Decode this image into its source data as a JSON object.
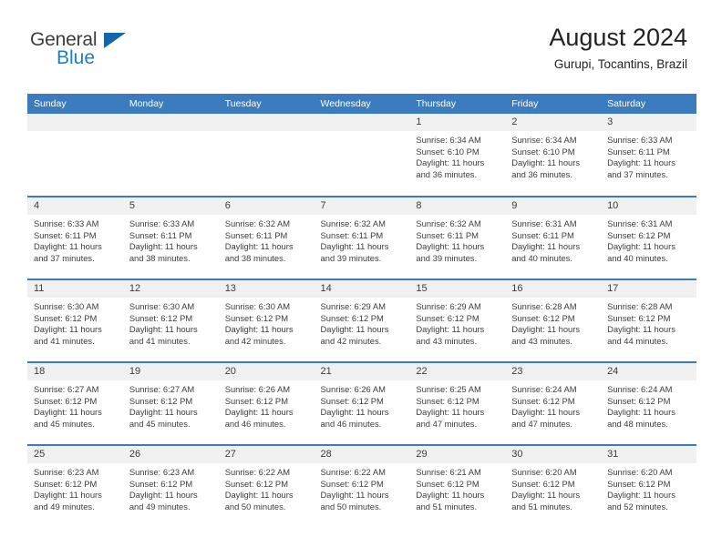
{
  "brand": {
    "name_part1": "General",
    "name_part2": "Blue",
    "triangle_color": "#1565a8",
    "blue_color": "#1b7fc4"
  },
  "header": {
    "title": "August 2024",
    "subtitle": "Gurupi, Tocantins, Brazil"
  },
  "theme": {
    "header_bg": "#3b7cbe",
    "row_border": "#3b7cbe",
    "daynum_bg": "#f0f0f0",
    "text": "#3c3c3c"
  },
  "weekdays": [
    "Sunday",
    "Monday",
    "Tuesday",
    "Wednesday",
    "Thursday",
    "Friday",
    "Saturday"
  ],
  "labels": {
    "sunrise_prefix": "Sunrise: ",
    "sunset_prefix": "Sunset: ",
    "daylight_prefix": "Daylight: "
  },
  "weeks": [
    [
      {
        "day": "",
        "sunrise": "",
        "sunset": "",
        "daylight": ""
      },
      {
        "day": "",
        "sunrise": "",
        "sunset": "",
        "daylight": ""
      },
      {
        "day": "",
        "sunrise": "",
        "sunset": "",
        "daylight": ""
      },
      {
        "day": "",
        "sunrise": "",
        "sunset": "",
        "daylight": ""
      },
      {
        "day": "1",
        "sunrise": "Sunrise: 6:34 AM",
        "sunset": "Sunset: 6:10 PM",
        "daylight": "Daylight: 11 hours and 36 minutes."
      },
      {
        "day": "2",
        "sunrise": "Sunrise: 6:34 AM",
        "sunset": "Sunset: 6:10 PM",
        "daylight": "Daylight: 11 hours and 36 minutes."
      },
      {
        "day": "3",
        "sunrise": "Sunrise: 6:33 AM",
        "sunset": "Sunset: 6:11 PM",
        "daylight": "Daylight: 11 hours and 37 minutes."
      }
    ],
    [
      {
        "day": "4",
        "sunrise": "Sunrise: 6:33 AM",
        "sunset": "Sunset: 6:11 PM",
        "daylight": "Daylight: 11 hours and 37 minutes."
      },
      {
        "day": "5",
        "sunrise": "Sunrise: 6:33 AM",
        "sunset": "Sunset: 6:11 PM",
        "daylight": "Daylight: 11 hours and 38 minutes."
      },
      {
        "day": "6",
        "sunrise": "Sunrise: 6:32 AM",
        "sunset": "Sunset: 6:11 PM",
        "daylight": "Daylight: 11 hours and 38 minutes."
      },
      {
        "day": "7",
        "sunrise": "Sunrise: 6:32 AM",
        "sunset": "Sunset: 6:11 PM",
        "daylight": "Daylight: 11 hours and 39 minutes."
      },
      {
        "day": "8",
        "sunrise": "Sunrise: 6:32 AM",
        "sunset": "Sunset: 6:11 PM",
        "daylight": "Daylight: 11 hours and 39 minutes."
      },
      {
        "day": "9",
        "sunrise": "Sunrise: 6:31 AM",
        "sunset": "Sunset: 6:11 PM",
        "daylight": "Daylight: 11 hours and 40 minutes."
      },
      {
        "day": "10",
        "sunrise": "Sunrise: 6:31 AM",
        "sunset": "Sunset: 6:12 PM",
        "daylight": "Daylight: 11 hours and 40 minutes."
      }
    ],
    [
      {
        "day": "11",
        "sunrise": "Sunrise: 6:30 AM",
        "sunset": "Sunset: 6:12 PM",
        "daylight": "Daylight: 11 hours and 41 minutes."
      },
      {
        "day": "12",
        "sunrise": "Sunrise: 6:30 AM",
        "sunset": "Sunset: 6:12 PM",
        "daylight": "Daylight: 11 hours and 41 minutes."
      },
      {
        "day": "13",
        "sunrise": "Sunrise: 6:30 AM",
        "sunset": "Sunset: 6:12 PM",
        "daylight": "Daylight: 11 hours and 42 minutes."
      },
      {
        "day": "14",
        "sunrise": "Sunrise: 6:29 AM",
        "sunset": "Sunset: 6:12 PM",
        "daylight": "Daylight: 11 hours and 42 minutes."
      },
      {
        "day": "15",
        "sunrise": "Sunrise: 6:29 AM",
        "sunset": "Sunset: 6:12 PM",
        "daylight": "Daylight: 11 hours and 43 minutes."
      },
      {
        "day": "16",
        "sunrise": "Sunrise: 6:28 AM",
        "sunset": "Sunset: 6:12 PM",
        "daylight": "Daylight: 11 hours and 43 minutes."
      },
      {
        "day": "17",
        "sunrise": "Sunrise: 6:28 AM",
        "sunset": "Sunset: 6:12 PM",
        "daylight": "Daylight: 11 hours and 44 minutes."
      }
    ],
    [
      {
        "day": "18",
        "sunrise": "Sunrise: 6:27 AM",
        "sunset": "Sunset: 6:12 PM",
        "daylight": "Daylight: 11 hours and 45 minutes."
      },
      {
        "day": "19",
        "sunrise": "Sunrise: 6:27 AM",
        "sunset": "Sunset: 6:12 PM",
        "daylight": "Daylight: 11 hours and 45 minutes."
      },
      {
        "day": "20",
        "sunrise": "Sunrise: 6:26 AM",
        "sunset": "Sunset: 6:12 PM",
        "daylight": "Daylight: 11 hours and 46 minutes."
      },
      {
        "day": "21",
        "sunrise": "Sunrise: 6:26 AM",
        "sunset": "Sunset: 6:12 PM",
        "daylight": "Daylight: 11 hours and 46 minutes."
      },
      {
        "day": "22",
        "sunrise": "Sunrise: 6:25 AM",
        "sunset": "Sunset: 6:12 PM",
        "daylight": "Daylight: 11 hours and 47 minutes."
      },
      {
        "day": "23",
        "sunrise": "Sunrise: 6:24 AM",
        "sunset": "Sunset: 6:12 PM",
        "daylight": "Daylight: 11 hours and 47 minutes."
      },
      {
        "day": "24",
        "sunrise": "Sunrise: 6:24 AM",
        "sunset": "Sunset: 6:12 PM",
        "daylight": "Daylight: 11 hours and 48 minutes."
      }
    ],
    [
      {
        "day": "25",
        "sunrise": "Sunrise: 6:23 AM",
        "sunset": "Sunset: 6:12 PM",
        "daylight": "Daylight: 11 hours and 49 minutes."
      },
      {
        "day": "26",
        "sunrise": "Sunrise: 6:23 AM",
        "sunset": "Sunset: 6:12 PM",
        "daylight": "Daylight: 11 hours and 49 minutes."
      },
      {
        "day": "27",
        "sunrise": "Sunrise: 6:22 AM",
        "sunset": "Sunset: 6:12 PM",
        "daylight": "Daylight: 11 hours and 50 minutes."
      },
      {
        "day": "28",
        "sunrise": "Sunrise: 6:22 AM",
        "sunset": "Sunset: 6:12 PM",
        "daylight": "Daylight: 11 hours and 50 minutes."
      },
      {
        "day": "29",
        "sunrise": "Sunrise: 6:21 AM",
        "sunset": "Sunset: 6:12 PM",
        "daylight": "Daylight: 11 hours and 51 minutes."
      },
      {
        "day": "30",
        "sunrise": "Sunrise: 6:20 AM",
        "sunset": "Sunset: 6:12 PM",
        "daylight": "Daylight: 11 hours and 51 minutes."
      },
      {
        "day": "31",
        "sunrise": "Sunrise: 6:20 AM",
        "sunset": "Sunset: 6:12 PM",
        "daylight": "Daylight: 11 hours and 52 minutes."
      }
    ]
  ]
}
